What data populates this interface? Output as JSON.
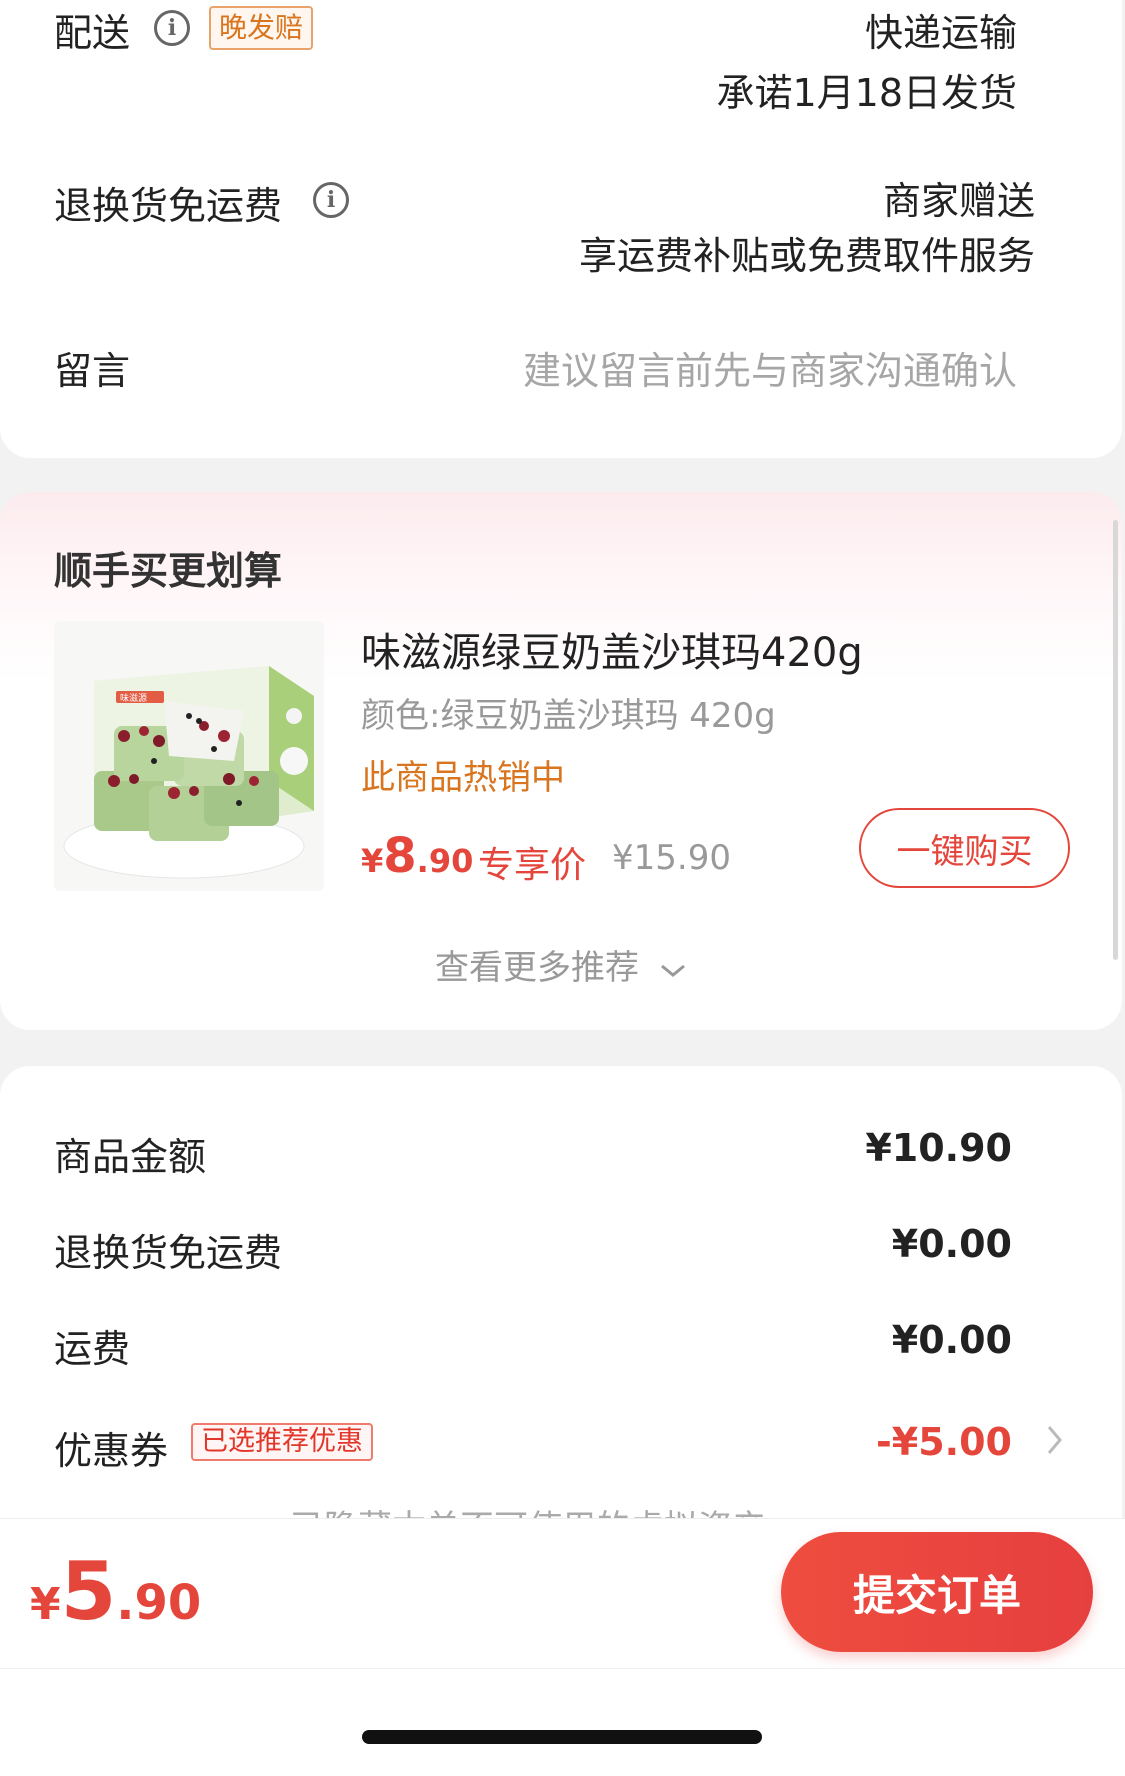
{
  "delivery": {
    "label": "配送",
    "tag": "晚发赔",
    "method": "快递运输",
    "promise": "承诺1月18日发货"
  },
  "return_shipping": {
    "label": "退换货免运费",
    "title": "商家赠送",
    "desc": "享运费补贴或免费取件服务"
  },
  "message": {
    "label": "留言",
    "placeholder": "建议留言前先与商家沟通确认"
  },
  "recommend": {
    "section_title": "顺手买更划算",
    "product": {
      "title": "味滋源绿豆奶盖沙琪玛420g",
      "variant": "颜色:绿豆奶盖沙琪玛 420g",
      "hot": "此商品热销中",
      "price_symbol": "¥",
      "price_int": "8",
      "price_dec": ".90",
      "price_label": "专享价",
      "orig_price": "¥15.90",
      "buy_label": "一键购买",
      "package_brand": "味滋源"
    },
    "more_label": "查看更多推荐"
  },
  "summary": {
    "goods_amount_label": "商品金额",
    "goods_amount": "¥10.90",
    "return_fee_label": "退换货免运费",
    "return_fee": "¥0.00",
    "shipping_label": "运费",
    "shipping": "¥0.00",
    "coupon_label": "优惠券",
    "coupon_tag": "已选推荐优惠",
    "coupon_value": "-¥5.00",
    "hidden_assets": "已隐藏本单不可使用的虚拟资产"
  },
  "footer": {
    "total_symbol": "¥",
    "total_int": "5",
    "total_dec": ".90",
    "submit_label": "提交订单"
  },
  "colors": {
    "accent_red": "#e5463b",
    "accent_orange": "#d9751e",
    "muted_text": "#999999"
  }
}
